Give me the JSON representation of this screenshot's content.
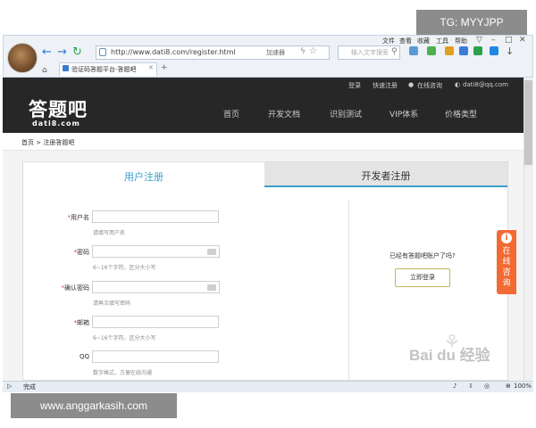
{
  "watermark_top": "TG: MYYJPP",
  "watermark_bottom": "www.anggarkasih.com",
  "browser": {
    "url": "http://www.dati8.com/register.html",
    "url_ext": "加速器",
    "search_placeholder": "输入文字搜索",
    "menu": [
      "文件",
      "查看",
      "收藏",
      "工具",
      "帮助"
    ],
    "tab_title": "验证码答题平台-答题吧",
    "new_tab": "+",
    "status_left": "完成",
    "zoom": "100%"
  },
  "site": {
    "logo": "答题吧",
    "logo_sub": "dati8.com",
    "top_links": [
      "登录",
      "快速注册",
      "在线咨询",
      "dati8@qq.com"
    ],
    "nav": [
      "首页",
      "开发文档",
      "识别测试",
      "VIP体系",
      "价格类型"
    ],
    "breadcrumb": "首页 > 注册答题吧"
  },
  "tabs": {
    "user": "用户注册",
    "developer": "开发者注册"
  },
  "form": {
    "fields": [
      {
        "label": "用户名",
        "required": true,
        "hint": "请填写用户名"
      },
      {
        "label": "密码",
        "required": true,
        "hint": "6~16个字符，区分大小写"
      },
      {
        "label": "确认密码",
        "required": true,
        "hint": "请再次填写密码"
      },
      {
        "label": "邮箱",
        "required": true,
        "hint": "6~16个字符，区分大小写"
      },
      {
        "label": "QQ",
        "required": false,
        "hint": "数字格式，方便在线沟通"
      }
    ],
    "required_mark": "*"
  },
  "side": {
    "already": "已经有答题吧账户了吗?",
    "login_button": "立即登录"
  },
  "consult": {
    "icon": "i",
    "text": "在线咨询"
  },
  "baidu_watermark": "Bai du 经验",
  "icons": {
    "back": "back-arrow-icon",
    "forward": "forward-arrow-icon",
    "refresh": "refresh-icon",
    "home": "home-icon"
  },
  "colors": {
    "accent": "#3aa0c8",
    "consult": "#f26b33",
    "header": "#272727"
  }
}
